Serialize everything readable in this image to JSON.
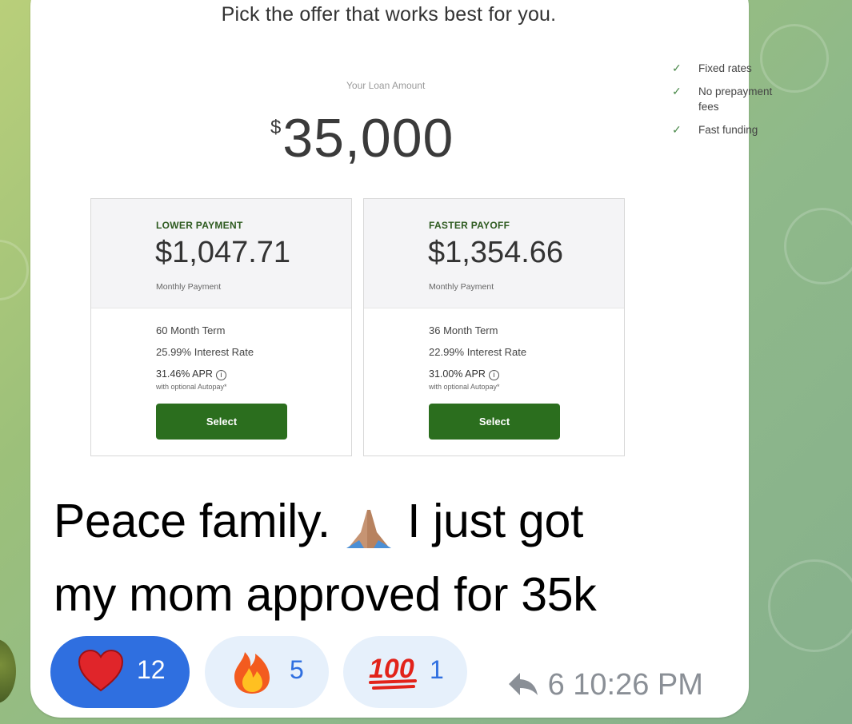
{
  "offer": {
    "heading": "Pick the offer that works best for you.",
    "loan_label": "Your Loan Amount",
    "loan_currency": "$",
    "loan_amount": "35,000",
    "features": [
      "Fixed rates",
      "No prepayment fees",
      "Fast funding"
    ],
    "cards": [
      {
        "title": "LOWER PAYMENT",
        "payment": "$1,047.71",
        "payment_label": "Monthly Payment",
        "term": "60 Month Term",
        "rate": "25.99% Interest Rate",
        "apr": "31.46% APR",
        "autopay": "with optional Autopay*",
        "button": "Select"
      },
      {
        "title": "FASTER PAYOFF",
        "payment": "$1,354.66",
        "payment_label": "Monthly Payment",
        "term": "36 Month Term",
        "rate": "22.99% Interest Rate",
        "apr": "31.00% APR",
        "autopay": "with optional Autopay*",
        "button": "Select"
      }
    ]
  },
  "message": {
    "text_line1_a": "Peace family.",
    "text_line1_b": "I just got",
    "text_line2": "my mom approved for 35k",
    "reactions": [
      {
        "icon": "heart-icon",
        "count": "12"
      },
      {
        "icon": "fire-icon",
        "count": "5"
      },
      {
        "icon": "hundred-points-icon",
        "count": "1"
      }
    ],
    "forwards": "6",
    "time": "10:26 PM"
  },
  "colors": {
    "accent_green": "#2b6e1e",
    "reaction_active": "#2f6fe0",
    "reaction_bg": "#e6f0fb"
  }
}
